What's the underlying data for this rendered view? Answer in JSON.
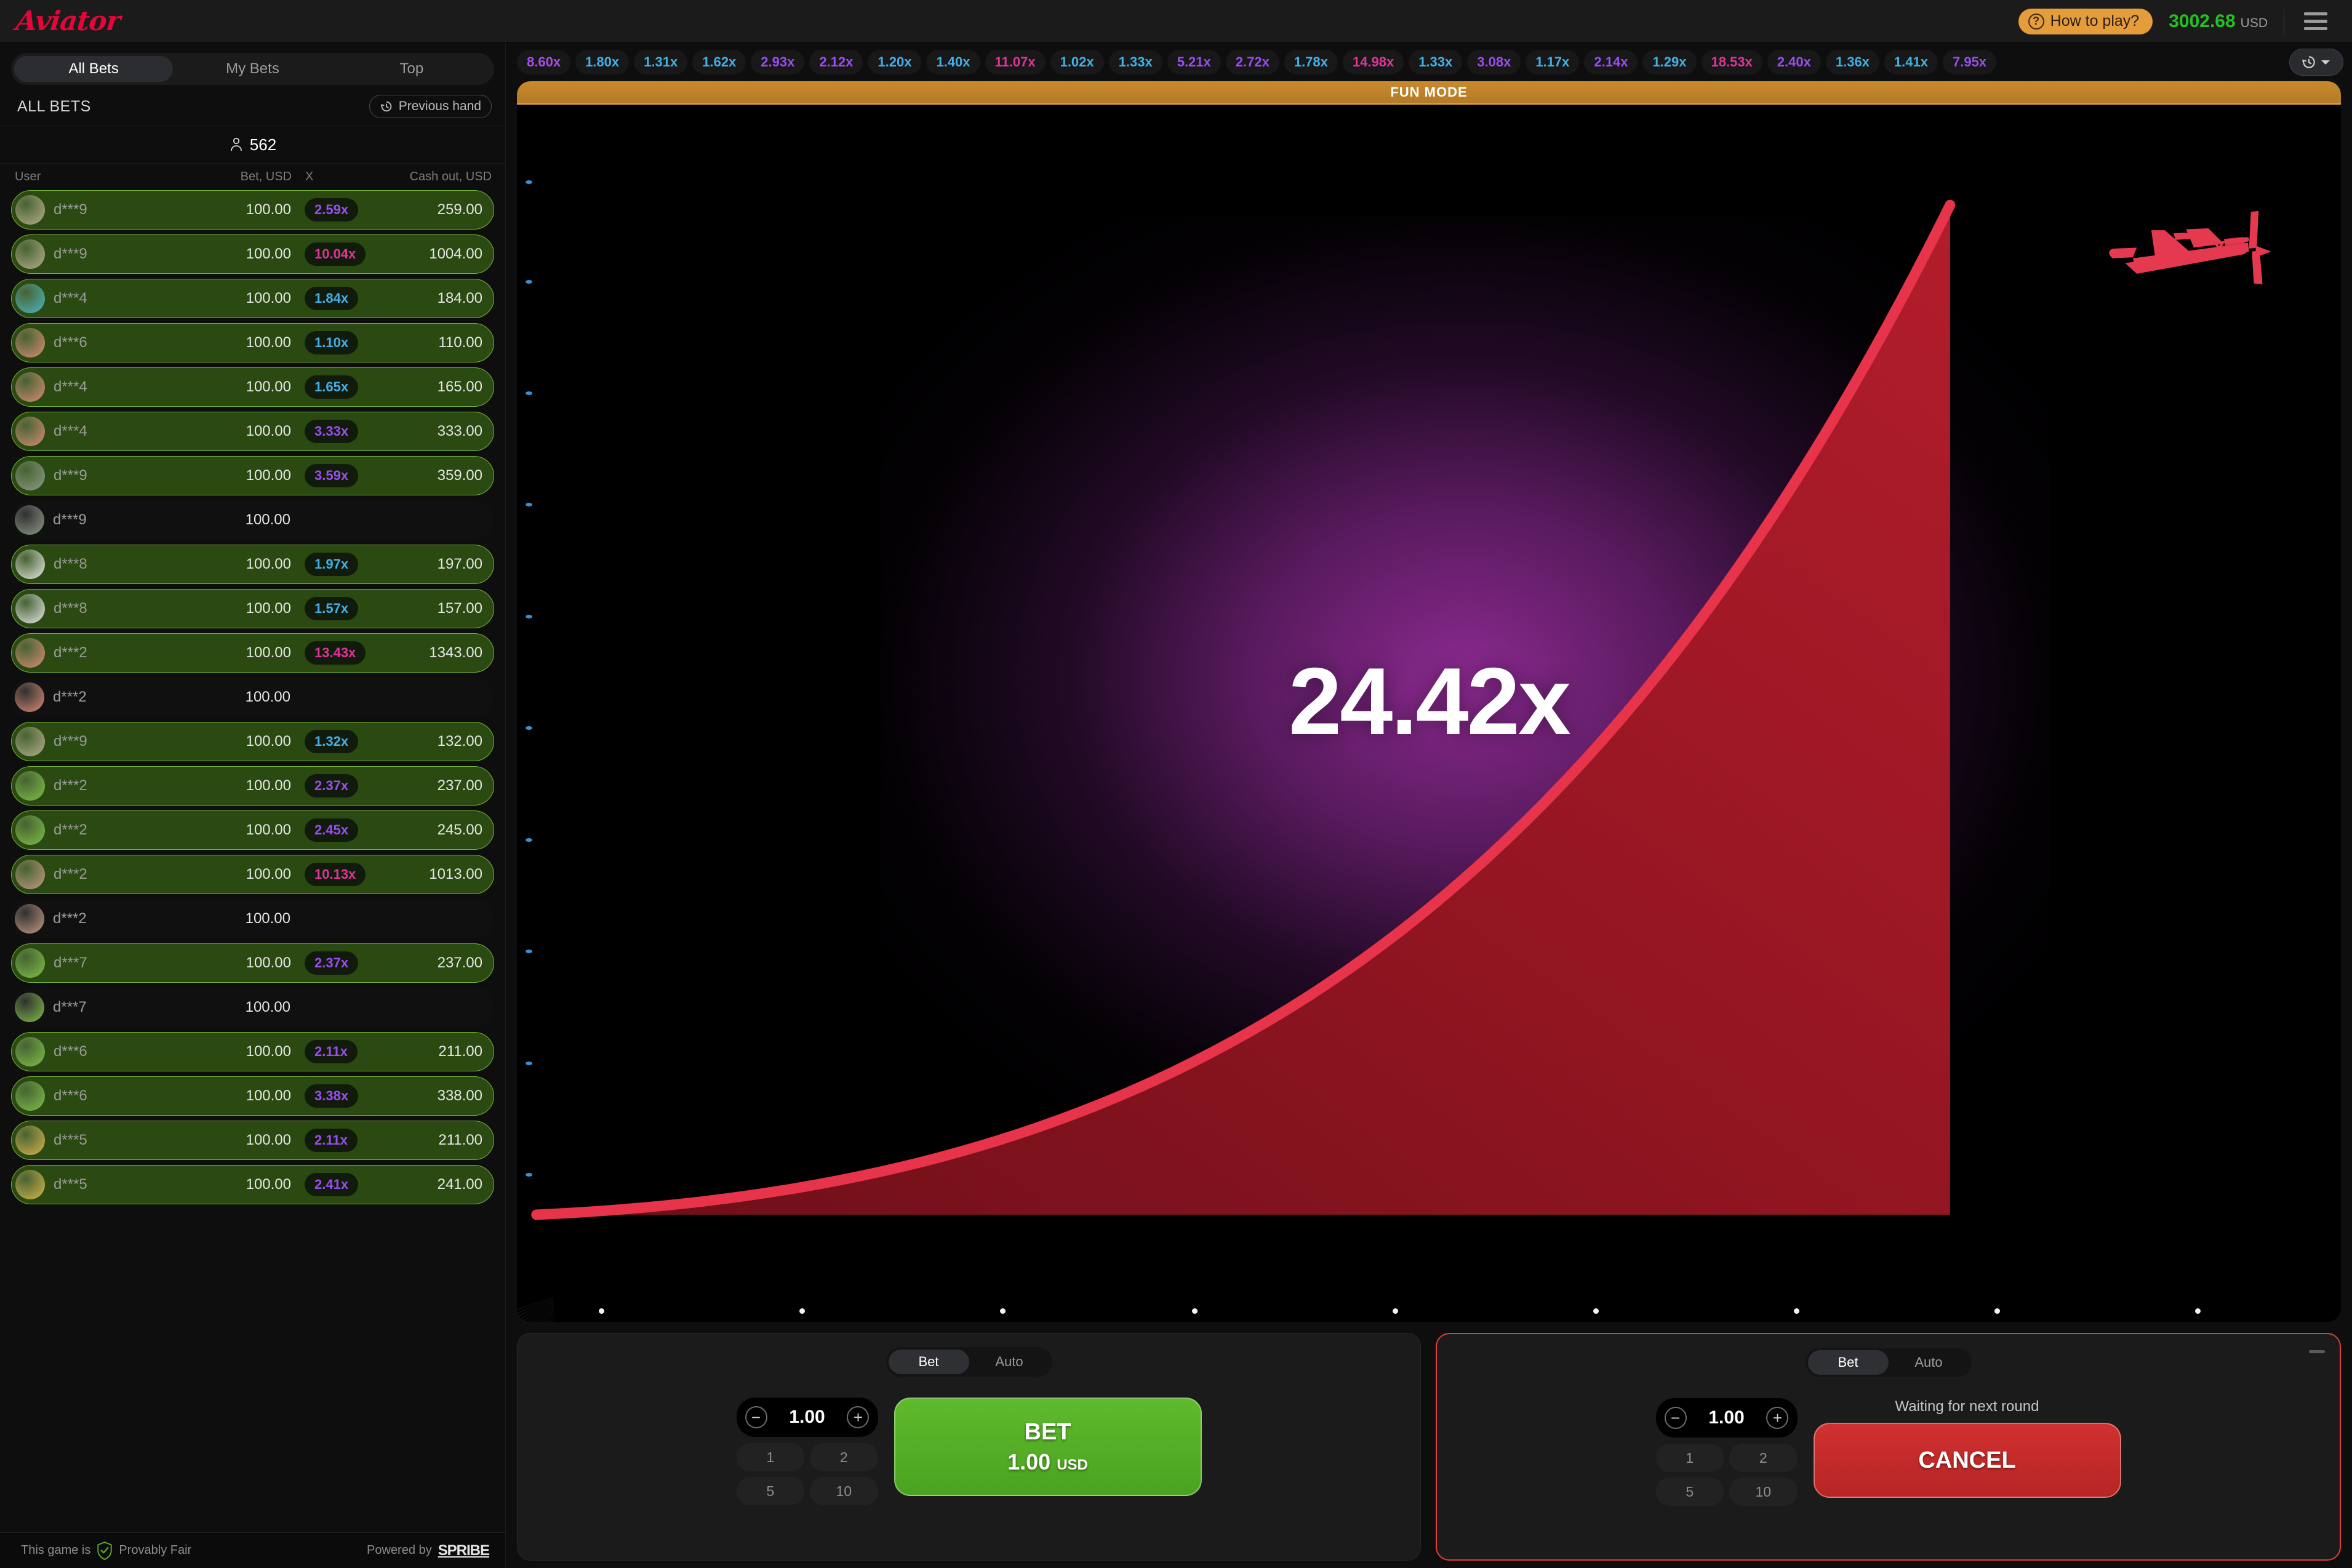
{
  "header": {
    "logo": "Aviator",
    "how_to_play": "How to play?",
    "how_to_play_icon": "question-circle-icon",
    "balance_amount": "3002.68",
    "balance_currency": "USD",
    "menu_icon": "hamburger-menu-icon",
    "accent_orange": "#e59d3c",
    "balance_green": "#25c025",
    "logo_red": "#e50539"
  },
  "sidebar": {
    "tabs": [
      {
        "label": "All Bets",
        "active": true
      },
      {
        "label": "My Bets",
        "active": false
      },
      {
        "label": "Top",
        "active": false
      }
    ],
    "section_title": "ALL BETS",
    "previous_hand": "Previous hand",
    "previous_hand_icon": "history-clock-icon",
    "players_icon": "person-icon",
    "players_count": "562",
    "columns": [
      "User",
      "Bet, USD",
      "X",
      "Cash out, USD"
    ],
    "bets": [
      {
        "user": "d***9",
        "bet": "100.00",
        "x": "2.59x",
        "cashout": "259.00",
        "won": true,
        "x_color": "#9a4df0",
        "avatar": "#b8ae8e"
      },
      {
        "user": "d***9",
        "bet": "100.00",
        "x": "10.04x",
        "cashout": "1004.00",
        "won": true,
        "x_color": "#e0349a",
        "avatar": "#b8ae8e"
      },
      {
        "user": "d***4",
        "bet": "100.00",
        "x": "1.84x",
        "cashout": "184.00",
        "won": true,
        "x_color": "#40b0e8",
        "avatar": "#4fb6c4"
      },
      {
        "user": "d***6",
        "bet": "100.00",
        "x": "1.10x",
        "cashout": "110.00",
        "won": true,
        "x_color": "#40b0e8",
        "avatar": "#d98d75"
      },
      {
        "user": "d***4",
        "bet": "100.00",
        "x": "1.65x",
        "cashout": "165.00",
        "won": true,
        "x_color": "#40b0e8",
        "avatar": "#d98d75"
      },
      {
        "user": "d***4",
        "bet": "100.00",
        "x": "3.33x",
        "cashout": "333.00",
        "won": true,
        "x_color": "#9a4df0",
        "avatar": "#d98d75"
      },
      {
        "user": "d***9",
        "bet": "100.00",
        "x": "3.59x",
        "cashout": "359.00",
        "won": true,
        "x_color": "#9a4df0",
        "avatar": "#8e9a8a"
      },
      {
        "user": "d***9",
        "bet": "100.00",
        "x": "",
        "cashout": "",
        "won": false,
        "x_color": "#40b0e8",
        "avatar": "#8e9a8a"
      },
      {
        "user": "d***8",
        "bet": "100.00",
        "x": "1.97x",
        "cashout": "197.00",
        "won": true,
        "x_color": "#40b0e8",
        "avatar": "#e8e8e8"
      },
      {
        "user": "d***8",
        "bet": "100.00",
        "x": "1.57x",
        "cashout": "157.00",
        "won": true,
        "x_color": "#40b0e8",
        "avatar": "#e8e8e8"
      },
      {
        "user": "d***2",
        "bet": "100.00",
        "x": "13.43x",
        "cashout": "1343.00",
        "won": true,
        "x_color": "#e0349a",
        "avatar": "#d98d75"
      },
      {
        "user": "d***2",
        "bet": "100.00",
        "x": "",
        "cashout": "",
        "won": false,
        "x_color": "#40b0e8",
        "avatar": "#d98d75"
      },
      {
        "user": "d***9",
        "bet": "100.00",
        "x": "1.32x",
        "cashout": "132.00",
        "won": true,
        "x_color": "#40b0e8",
        "avatar": "#b8ae8e"
      },
      {
        "user": "d***2",
        "bet": "100.00",
        "x": "2.37x",
        "cashout": "237.00",
        "won": true,
        "x_color": "#9a4df0",
        "avatar": "#7fbf4a"
      },
      {
        "user": "d***2",
        "bet": "100.00",
        "x": "2.45x",
        "cashout": "245.00",
        "won": true,
        "x_color": "#9a4df0",
        "avatar": "#7fbf4a"
      },
      {
        "user": "d***2",
        "bet": "100.00",
        "x": "10.13x",
        "cashout": "1013.00",
        "won": true,
        "x_color": "#e0349a",
        "avatar": "#c59a84"
      },
      {
        "user": "d***2",
        "bet": "100.00",
        "x": "",
        "cashout": "",
        "won": false,
        "x_color": "#40b0e8",
        "avatar": "#c59a84"
      },
      {
        "user": "d***7",
        "bet": "100.00",
        "x": "2.37x",
        "cashout": "237.00",
        "won": true,
        "x_color": "#9a4df0",
        "avatar": "#7fbf4a"
      },
      {
        "user": "d***7",
        "bet": "100.00",
        "x": "",
        "cashout": "",
        "won": false,
        "x_color": "#40b0e8",
        "avatar": "#7fbf4a"
      },
      {
        "user": "d***6",
        "bet": "100.00",
        "x": "2.11x",
        "cashout": "211.00",
        "won": true,
        "x_color": "#9a4df0",
        "avatar": "#7fbf4a"
      },
      {
        "user": "d***6",
        "bet": "100.00",
        "x": "3.38x",
        "cashout": "338.00",
        "won": true,
        "x_color": "#9a4df0",
        "avatar": "#7fbf4a"
      },
      {
        "user": "d***5",
        "bet": "100.00",
        "x": "2.11x",
        "cashout": "211.00",
        "won": true,
        "x_color": "#9a4df0",
        "avatar": "#d8b54e"
      },
      {
        "user": "d***5",
        "bet": "100.00",
        "x": "2.41x",
        "cashout": "241.00",
        "won": true,
        "x_color": "#9a4df0",
        "avatar": "#d8b54e"
      }
    ]
  },
  "footer": {
    "fair_prefix": "This game is",
    "fair_label": "Provably Fair",
    "shield_icon": "shield-check-icon",
    "powered_by": "Powered by",
    "brand": "SPRIBE"
  },
  "history": {
    "toggle_icon": "history-clock-icon",
    "toggle_chevron": "chevron-down-icon",
    "items": [
      {
        "value": "8.60x",
        "color": "#a84ef0"
      },
      {
        "value": "1.80x",
        "color": "#40b0e8"
      },
      {
        "value": "1.31x",
        "color": "#40b0e8"
      },
      {
        "value": "1.62x",
        "color": "#40b0e8"
      },
      {
        "value": "2.93x",
        "color": "#9a4df0"
      },
      {
        "value": "2.12x",
        "color": "#9a4df0"
      },
      {
        "value": "1.20x",
        "color": "#40b0e8"
      },
      {
        "value": "1.40x",
        "color": "#40b0e8"
      },
      {
        "value": "11.07x",
        "color": "#e0349a"
      },
      {
        "value": "1.02x",
        "color": "#40b0e8"
      },
      {
        "value": "1.33x",
        "color": "#40b0e8"
      },
      {
        "value": "5.21x",
        "color": "#9a4df0"
      },
      {
        "value": "2.72x",
        "color": "#9a4df0"
      },
      {
        "value": "1.78x",
        "color": "#40b0e8"
      },
      {
        "value": "14.98x",
        "color": "#e0349a"
      },
      {
        "value": "1.33x",
        "color": "#40b0e8"
      },
      {
        "value": "3.08x",
        "color": "#9a4df0"
      },
      {
        "value": "1.17x",
        "color": "#40b0e8"
      },
      {
        "value": "2.14x",
        "color": "#9a4df0"
      },
      {
        "value": "1.29x",
        "color": "#40b0e8"
      },
      {
        "value": "18.53x",
        "color": "#e0349a"
      },
      {
        "value": "2.40x",
        "color": "#9a4df0"
      },
      {
        "value": "1.36x",
        "color": "#40b0e8"
      },
      {
        "value": "1.41x",
        "color": "#40b0e8"
      },
      {
        "value": "7.95x",
        "color": "#9a4df0"
      }
    ]
  },
  "canvas": {
    "fun_mode_banner": "FUN MODE",
    "multiplier": "24.42x",
    "plane_icon": "airplane-icon",
    "curve_color": "#e8344a",
    "fill_color": "#8c1520",
    "glow_color": "#962d9b"
  },
  "bet_panel_left": {
    "tabs": [
      {
        "label": "Bet",
        "active": true
      },
      {
        "label": "Auto",
        "active": false
      }
    ],
    "stake": "1.00",
    "minus_icon": "minus-circle-icon",
    "plus_icon": "plus-circle-icon",
    "quick_amounts": [
      "1",
      "2",
      "5",
      "10"
    ],
    "button_label": "BET",
    "button_amount": "1.00",
    "button_currency": "USD"
  },
  "bet_panel_right": {
    "tabs": [
      {
        "label": "Bet",
        "active": true
      },
      {
        "label": "Auto",
        "active": false
      }
    ],
    "stake": "1.00",
    "minus_icon": "minus-circle-icon",
    "plus_icon": "plus-circle-icon",
    "quick_amounts": [
      "1",
      "2",
      "5",
      "10"
    ],
    "status_text": "Waiting for next round",
    "button_label": "CANCEL",
    "minimize_icon": "minimize-icon"
  }
}
